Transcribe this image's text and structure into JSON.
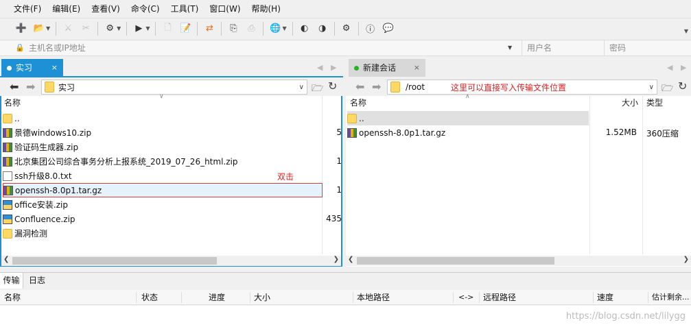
{
  "menu": [
    "文件(F)",
    "编辑(E)",
    "查看(V)",
    "命令(C)",
    "工具(T)",
    "窗口(W)",
    "帮助(H)"
  ],
  "address": {
    "host_placeholder": "主机名或IP地址",
    "user_placeholder": "用户名",
    "pass_placeholder": "密码"
  },
  "tabs": {
    "left": {
      "label": "实习",
      "close": "×"
    },
    "right": {
      "label": "新建会话",
      "close": "×"
    }
  },
  "left": {
    "path": "实习",
    "col_name": "名称",
    "files": [
      {
        "name": "..",
        "size": "",
        "type": "folder"
      },
      {
        "name": "景德windows10.zip",
        "size": "5",
        "type": "rar"
      },
      {
        "name": "验证码生成器.zip",
        "size": "",
        "type": "rar"
      },
      {
        "name": "北京集团公司综合事务分析上报系统_2019_07_26_html.zip",
        "size": "1",
        "type": "rar"
      },
      {
        "name": "ssh升级8.0.txt",
        "size": "",
        "type": "txt"
      },
      {
        "name": "openssh-8.0p1.tar.gz",
        "size": "1",
        "type": "rar"
      },
      {
        "name": "office安装.zip",
        "size": "",
        "type": "zip"
      },
      {
        "name": "Confluence.zip",
        "size": "435",
        "type": "zip"
      },
      {
        "name": "漏洞检测",
        "size": "",
        "type": "folder"
      }
    ],
    "annotation": "双击"
  },
  "right": {
    "path": "/root",
    "annotation": "这里可以直接写入传输文件位置",
    "col_name": "名称",
    "col_size": "大小",
    "col_type": "类型",
    "files": [
      {
        "name": "..",
        "size": "",
        "type": ""
      },
      {
        "name": "openssh-8.0p1.tar.gz",
        "size": "1.52MB",
        "type": "360压缩"
      }
    ]
  },
  "bottom_tabs": [
    "传输",
    "日志"
  ],
  "transfer_cols": [
    "名称",
    "状态",
    "进度",
    "大小",
    "本地路径",
    "<->",
    "远程路径",
    "速度",
    "估计剩余..."
  ],
  "watermark": "https://blog.csdn.net/lilygg",
  "colors": {
    "active_tab": "#1e90d6",
    "annotation": "#e02020",
    "highlight_border": "#d04040"
  }
}
